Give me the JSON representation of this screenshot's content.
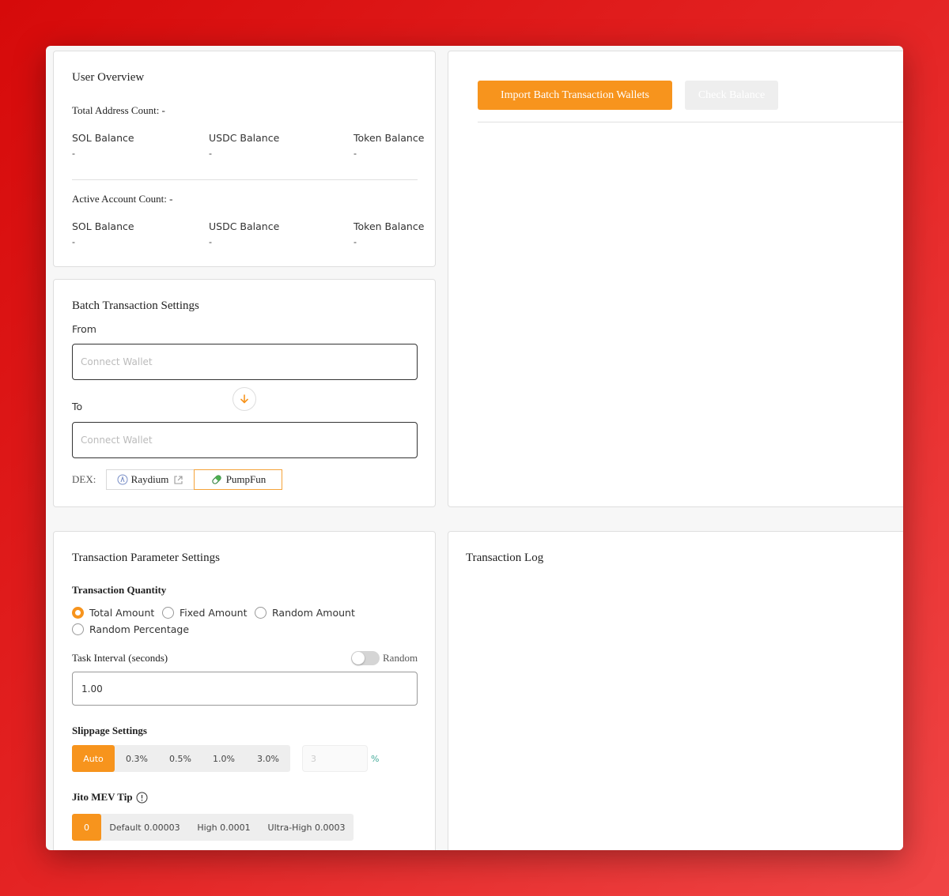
{
  "accent_color": "#f7941d",
  "overview": {
    "title": "User Overview",
    "total_address_count": "Total Address Count: -",
    "active_account_count": "Active Account Count: -",
    "total_balances": [
      {
        "label": "SOL Balance",
        "value": "-"
      },
      {
        "label": "USDC Balance",
        "value": "-"
      },
      {
        "label": "Token Balance",
        "value": "-"
      }
    ],
    "active_balances": [
      {
        "label": "SOL Balance",
        "value": "-"
      },
      {
        "label": "USDC Balance",
        "value": "-"
      },
      {
        "label": "Token Balance",
        "value": "-"
      }
    ]
  },
  "batch": {
    "title": "Batch Transaction Settings",
    "from_label": "From",
    "from_placeholder": "Connect Wallet",
    "to_label": "To",
    "to_placeholder": "Connect Wallet",
    "dex_label": "DEX:",
    "dex_options": [
      {
        "label": "Raydium",
        "icon": "raydium-icon",
        "external": true,
        "active": false
      },
      {
        "label": "PumpFun",
        "icon": "pill-icon",
        "active": true
      }
    ]
  },
  "wallets": {
    "import_button": "Import Batch Transaction Wallets",
    "check_button": "Check Balance"
  },
  "params": {
    "title": "Transaction Parameter Settings",
    "quantity_title": "Transaction Quantity",
    "quantity_options": [
      {
        "label": "Total Amount",
        "selected": true
      },
      {
        "label": "Fixed Amount",
        "selected": false
      },
      {
        "label": "Random Amount",
        "selected": false
      },
      {
        "label": "Random Percentage",
        "selected": false
      }
    ],
    "interval_label": "Task Interval (seconds)",
    "random_label": "Random",
    "random_on": false,
    "interval_value": "1.00",
    "slippage_title": "Slippage Settings",
    "slippage_options": [
      "Auto",
      "0.3%",
      "0.5%",
      "1.0%",
      "3.0%"
    ],
    "slippage_selected": "Auto",
    "slippage_custom_placeholder": "3",
    "slippage_unit": "%",
    "jito_title": "Jito MEV Tip",
    "jito_options": [
      "0",
      "Default 0.00003",
      "High 0.0001",
      "Ultra-High 0.0003"
    ],
    "jito_selected": "0"
  },
  "log": {
    "title": "Transaction Log"
  }
}
